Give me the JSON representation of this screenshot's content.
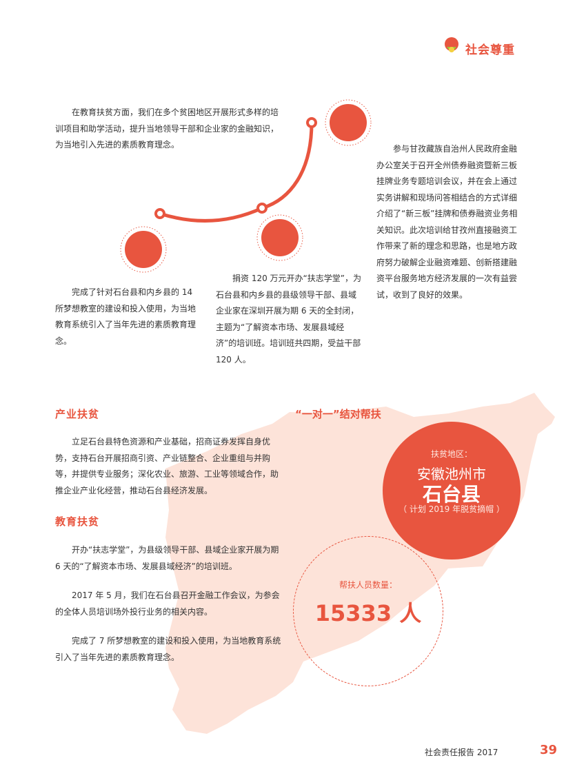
{
  "header": {
    "section": "社会尊重"
  },
  "top": {
    "para_finance": "在教育扶贫方面，我们在多个贫困地区开展形式多样的培训项目和助学活动，提升当地领导干部和企业家的金融知识，为当地引入先进的素质教育理念。",
    "para_ganzi": "参与甘孜藏族自治州人民政府金融办公室关于召开全州债券融资暨新三板挂牌业务专题培训会议，并在会上通过实务讲解和现场问答相结合的方式详细介绍了“新三板”挂牌和债券融资业务相关知识。此次培训给甘孜州直接融资工作带来了新的理念和思路，也是地方政府努力破解企业融资难题、创新搭建融资平台服务地方经济发展的一次有益尝试，收到了良好的效果。",
    "para_schools": "完成了针对石台县和内乡县的 14 所梦想教室的建设和投入使用，为当地教育系统引入了当年先进的素质教育理念。",
    "para_training": "捐资 120 万元开办“扶志学堂”，为石台县和内乡县的县级领导干部、县域企业家在深圳开展为期 6 天的全封闭，主题为“了解资本市场、发展县域经济”的培训班。培训班共四期，受益干部 120 人。"
  },
  "industry": {
    "title": "产业扶贫",
    "text": "立足石台县特色资源和产业基础，招商证券发挥自身优势，支持石台开展招商引资、产业链整合、企业重组与并购等，并提供专业服务；深化农业、旅游、工业等领域合作，助推企业产业化经营，推动石台县经济发展。"
  },
  "education": {
    "title": "教育扶贫",
    "p1": "开办“扶志学堂”，为县级领导干部、县域企业家开展为期 6 天的“了解资本市场、发展县域经济”的培训班。",
    "p2": "2017 年 5 月，我们在石台县召开金融工作会议，为参会的全体人员培训场外投行业务的相关内容。",
    "p3": "完成了 7 所梦想教室的建设和投入使用，为当地教育系统引入了当年先进的素质教育理念。"
  },
  "pairing": {
    "title": "“一对一”结对帮扶",
    "area_label": "扶贫地区：",
    "city": "安徽池州市",
    "county": "石台县",
    "note": "（ 计划 2019 年脱贫摘帽 ）",
    "count_label": "帮扶人员数量：",
    "count_value": "15333 人"
  },
  "footer": {
    "report": "社会责任报告 2017",
    "page": "39"
  },
  "colors": {
    "accent": "#e8553f",
    "map": "#fde3d9"
  }
}
